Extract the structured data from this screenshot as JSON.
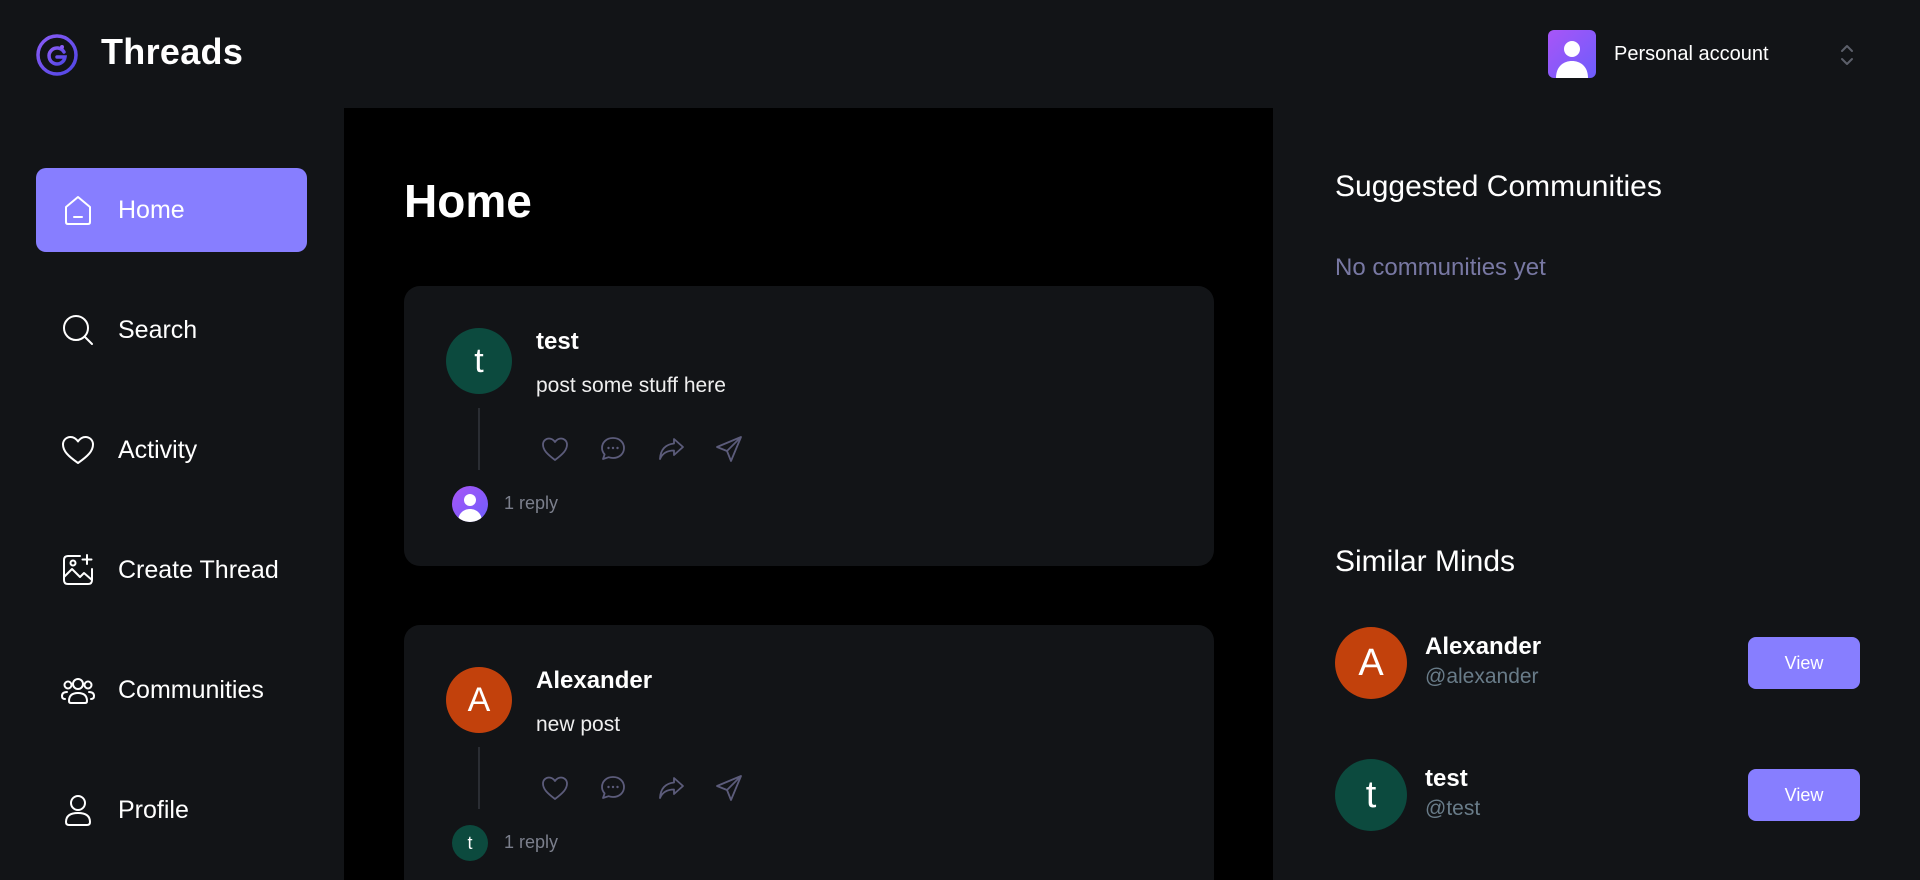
{
  "app": {
    "brand": "Threads",
    "account_label": "Personal account",
    "accent_color": "#877eff"
  },
  "sidebar": {
    "items": [
      {
        "label": "Home",
        "icon": "home-icon",
        "active": true
      },
      {
        "label": "Search",
        "icon": "search-icon",
        "active": false
      },
      {
        "label": "Activity",
        "icon": "heart-icon",
        "active": false
      },
      {
        "label": "Create Thread",
        "icon": "create-image-icon",
        "active": false
      },
      {
        "label": "Communities",
        "icon": "users-icon",
        "active": false
      },
      {
        "label": "Profile",
        "icon": "user-icon",
        "active": false
      }
    ]
  },
  "feed": {
    "title": "Home",
    "posts": [
      {
        "author": "test",
        "avatar_letter": "t",
        "avatar_color": "#0c4a3e",
        "content": "post some stuff here",
        "reply_count": "1 reply",
        "reply_avatar_letter": ""
      },
      {
        "author": "Alexander",
        "avatar_letter": "A",
        "avatar_color": "#c2410c",
        "content": "new post",
        "reply_count": "1 reply",
        "reply_avatar_letter": "t"
      }
    ]
  },
  "right": {
    "communities_heading": "Suggested Communities",
    "communities_empty": "No communities yet",
    "similar_heading": "Similar Minds",
    "similar": [
      {
        "name": "Alexander",
        "handle": "@alexander",
        "avatar_letter": "A",
        "avatar_color": "#c2410c",
        "button": "View"
      },
      {
        "name": "test",
        "handle": "@test",
        "avatar_letter": "t",
        "avatar_color": "#0c4a3e",
        "button": "View"
      }
    ]
  }
}
